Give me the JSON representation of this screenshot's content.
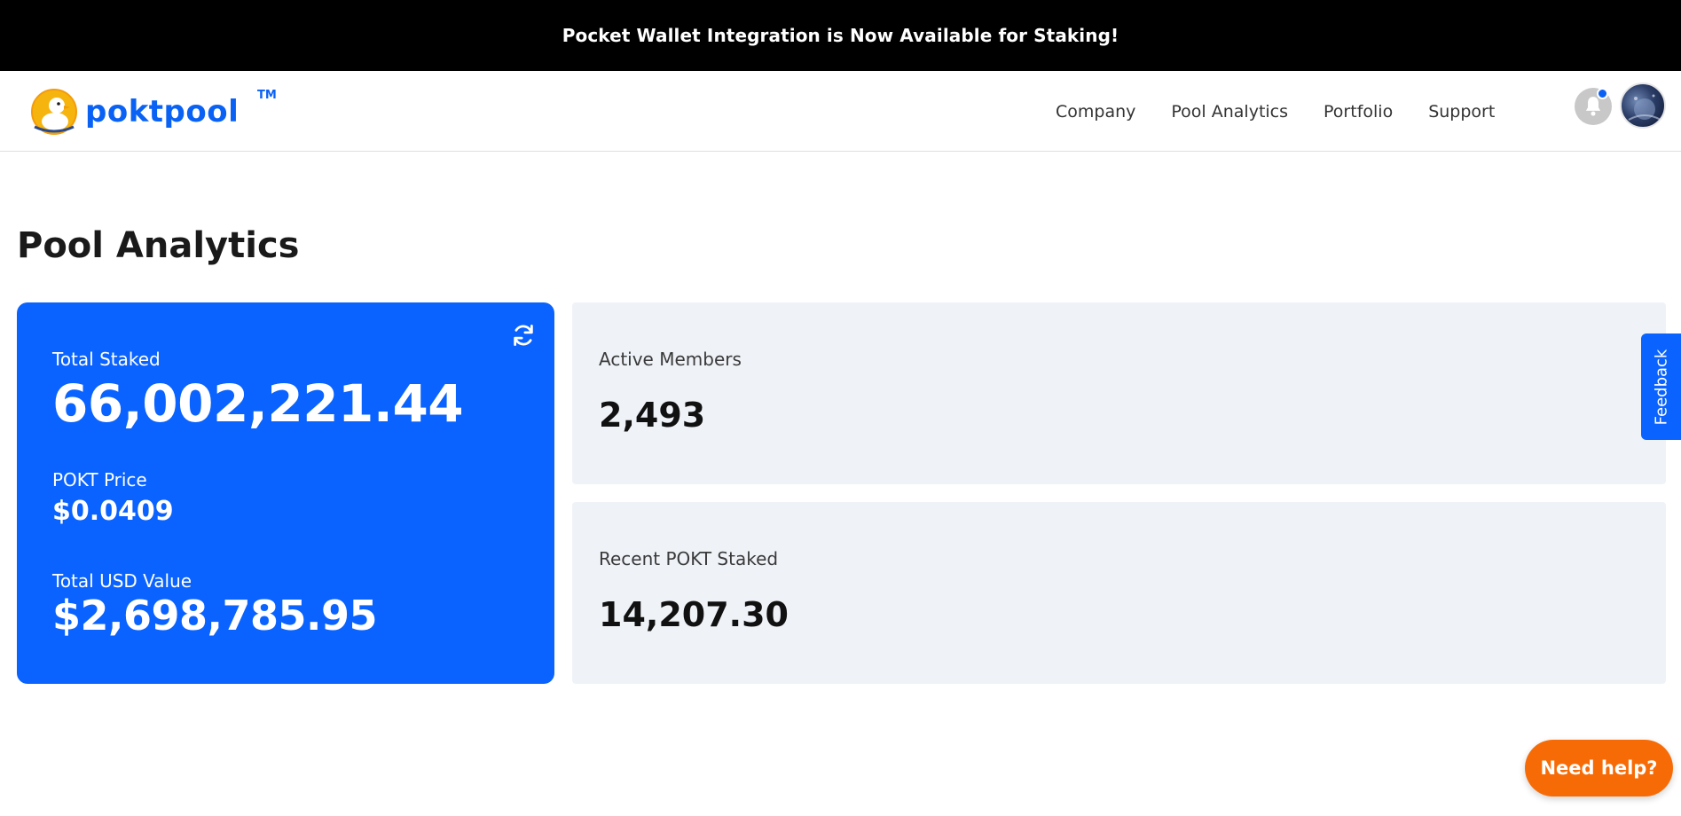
{
  "announcement": {
    "text": "Pocket Wallet Integration is Now Available for Staking!"
  },
  "brand": {
    "name": "poktpool",
    "trademark": "TM"
  },
  "nav": {
    "links": [
      {
        "label": "Company"
      },
      {
        "label": "Pool Analytics"
      },
      {
        "label": "Portfolio"
      },
      {
        "label": "Support"
      }
    ],
    "icons": {
      "notifications": "bell-icon",
      "notification_dot_color": "#0a62f5"
    }
  },
  "page": {
    "title": "Pool Analytics"
  },
  "summary_card": {
    "total_staked_label": "Total Staked",
    "total_staked_value": "66,002,221.44",
    "price_label": "POKT Price",
    "price_value": "$0.0409",
    "usd_label": "Total USD Value",
    "usd_value": "$2,698,785.95",
    "refresh_icon": "refresh-icon",
    "color": "#0a63ff"
  },
  "stats": {
    "active_members": {
      "label": "Active Members",
      "value": "2,493"
    },
    "recent_staked": {
      "label": "Recent POKT Staked",
      "value": "14,207.30"
    }
  },
  "feedback": {
    "label": "Feedback"
  },
  "help": {
    "label": "Need help?",
    "color": "#f76b07"
  }
}
